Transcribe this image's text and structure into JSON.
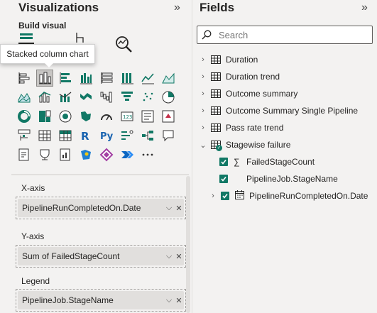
{
  "visualizations": {
    "title": "Visualizations",
    "collapse_glyph": "»",
    "build_visual_label": "Build visual",
    "tooltip": "Stacked column chart",
    "viz_icons": [
      "stacked-bar-chart-icon",
      "stacked-column-chart-icon",
      "clustered-bar-chart-icon",
      "clustered-column-chart-icon",
      "100-stacked-bar-chart-icon",
      "100-stacked-column-chart-icon",
      "line-chart-icon",
      "area-chart-icon",
      "stacked-area-chart-icon",
      "line-and-stacked-column-chart-icon",
      "line-and-clustered-column-chart-icon",
      "ribbon-chart-icon",
      "waterfall-chart-icon",
      "funnel-chart-icon",
      "scatter-chart-icon",
      "pie-chart-icon",
      "donut-chart-icon",
      "treemap-icon",
      "map-icon",
      "filled-map-icon",
      "gauge-icon",
      "card-icon",
      "multi-row-card-icon",
      "kpi-icon",
      "slicer-icon",
      "table-icon",
      "matrix-icon",
      "r-script-visual-icon",
      "python-visual-icon",
      "key-influencers-icon",
      "decomposition-tree-icon",
      "qna-icon",
      "smart-narrative-icon",
      "metrics-icon",
      "paginated-report-icon",
      "azure-map-icon",
      "power-apps-icon",
      "power-automate-icon",
      "more-visuals-icon"
    ],
    "selected_icon": "stacked-column-chart-icon",
    "wells": {
      "x_axis": {
        "label": "X-axis",
        "field": "PipelineRunCompletedOn.Date"
      },
      "y_axis": {
        "label": "Y-axis",
        "field": "Sum of FailedStageCount"
      },
      "legend": {
        "label": "Legend",
        "field": "PipelineJob.StageName"
      }
    }
  },
  "fields": {
    "title": "Fields",
    "collapse_glyph": "»",
    "search_placeholder": "Search",
    "tables": [
      {
        "name": "Duration"
      },
      {
        "name": "Duration trend"
      },
      {
        "name": "Outcome summary"
      },
      {
        "name": "Outcome Summary Single Pipeline"
      },
      {
        "name": "Pass rate trend"
      },
      {
        "name": "Stagewise failure"
      }
    ],
    "stagewise_fields": [
      {
        "name": "FailedStageCount"
      },
      {
        "name": "PipelineJob.StageName"
      },
      {
        "name": "PipelineRunCompletedOn.Date"
      }
    ]
  },
  "colors": {
    "accent_teal": "#117865",
    "selected_bg": "#c8c6c4",
    "pane_bg": "#f3f2f1"
  }
}
